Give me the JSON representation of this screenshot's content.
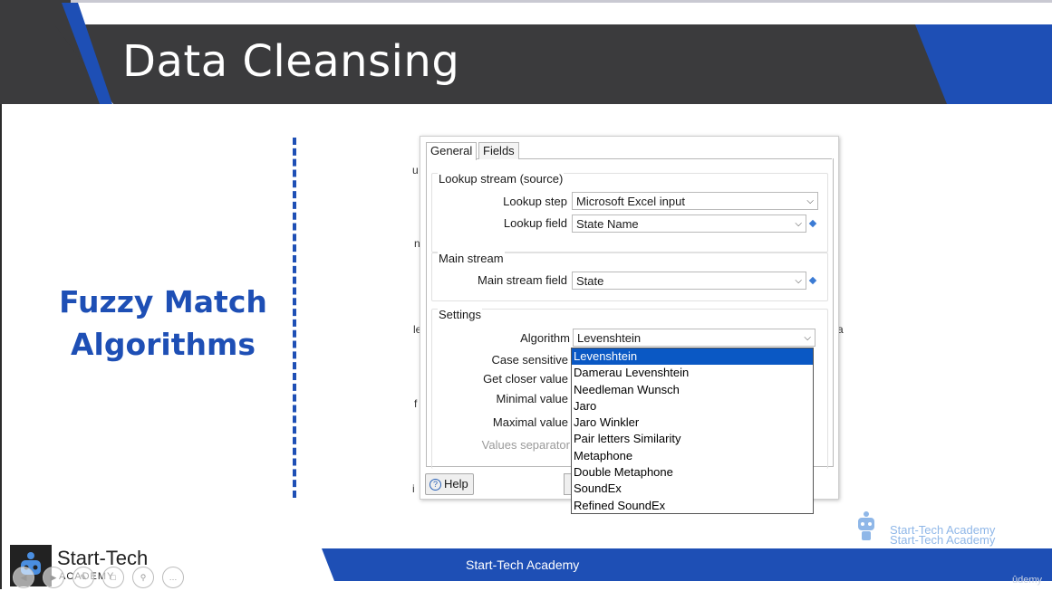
{
  "slide": {
    "title": "Data Cleansing",
    "side_heading_line1": "Fuzzy Match",
    "side_heading_line2": "Algorithms"
  },
  "dialog": {
    "tabs": [
      "General",
      "Fields"
    ],
    "lookup_group": {
      "title": "Lookup stream (source)",
      "lookup_step_label": "Lookup step",
      "lookup_step_value": "Microsoft Excel input",
      "lookup_field_label": "Lookup field",
      "lookup_field_value": "State Name"
    },
    "main_group": {
      "title": "Main stream",
      "main_field_label": "Main stream field",
      "main_field_value": "State"
    },
    "settings_group": {
      "title": "Settings",
      "algorithm_label": "Algorithm",
      "algorithm_value": "Levenshtein",
      "case_sensitive_label": "Case sensitive",
      "get_closer_label": "Get closer value",
      "minimal_label": "Minimal value",
      "maximal_label": "Maximal value",
      "separator_label": "Values separator"
    },
    "help_label": "Help",
    "algorithm_options": [
      "Levenshtein",
      "Damerau Levenshtein",
      "Needleman Wunsch",
      "Jaro",
      "Jaro Winkler",
      "Pair letters Similarity",
      "Metaphone",
      "Double Metaphone",
      "SoundEx",
      "Refined SoundEx"
    ]
  },
  "footer": {
    "center_text": "Start-Tech Academy",
    "brand": "Start-Tech",
    "brand_sub": "ACADEMY",
    "watermark_line1": "Start-Tech Academy",
    "watermark_line2": "Start-Tech Academy",
    "udemy": "ûdemy"
  },
  "colors": {
    "header_dark": "#3b3b3d",
    "accent_blue": "#1e4fb5",
    "selection_blue": "#0a58c4"
  }
}
